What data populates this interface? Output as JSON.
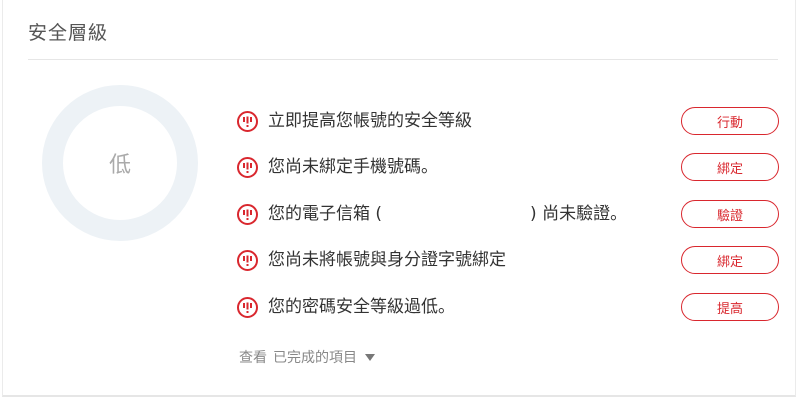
{
  "panel": {
    "title": "安全層級"
  },
  "gauge": {
    "level_label": "低",
    "track_color": "#edf2f6"
  },
  "accent_color": "#d9272e",
  "items": [
    {
      "text": "立即提高您帳號的安全等級",
      "button": "行動",
      "icon": "alert-circle-icon"
    },
    {
      "text": "您尚未綁定手機號碼。",
      "button": "綁定",
      "icon": "alert-circle-icon"
    },
    {
      "text_before": "您的電子信箱 (",
      "text_after": ") 尚未驗證。",
      "button": "驗證",
      "icon": "alert-circle-icon"
    },
    {
      "text": "您尚未將帳號與身分證字號綁定",
      "button": "綁定",
      "icon": "alert-circle-icon"
    },
    {
      "text": "您的密碼安全等級過低。",
      "button": "提高",
      "icon": "alert-circle-icon"
    }
  ],
  "footer": {
    "view_label": "查看",
    "completed_label": "已完成的項目",
    "icon": "caret-down-icon"
  }
}
